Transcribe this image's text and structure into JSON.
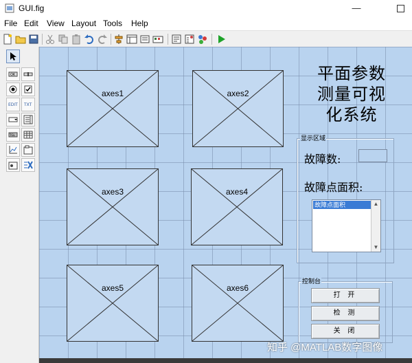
{
  "window": {
    "title": "GUI.fig"
  },
  "menu": [
    "File",
    "Edit",
    "View",
    "Layout",
    "Tools",
    "Help"
  ],
  "axes": [
    "axes1",
    "axes2",
    "axes3",
    "axes4",
    "axes5",
    "axes6"
  ],
  "big_title": [
    "平面参数",
    "测量可视",
    "化系统"
  ],
  "display_panel": {
    "title": "显示区域",
    "fault_count_label": "故障数:",
    "fault_area_label": "故障点面积:",
    "listbox_item": "故障点面积"
  },
  "control_panel": {
    "title": "控制台",
    "buttons": [
      "打 开",
      "检 测",
      "关 闭"
    ]
  },
  "watermark": "知乎 @MATLAB数字图像",
  "colors": {
    "canvas": "#b9d3ef",
    "grid": "#788caa",
    "selection": "#3a7bd5"
  }
}
